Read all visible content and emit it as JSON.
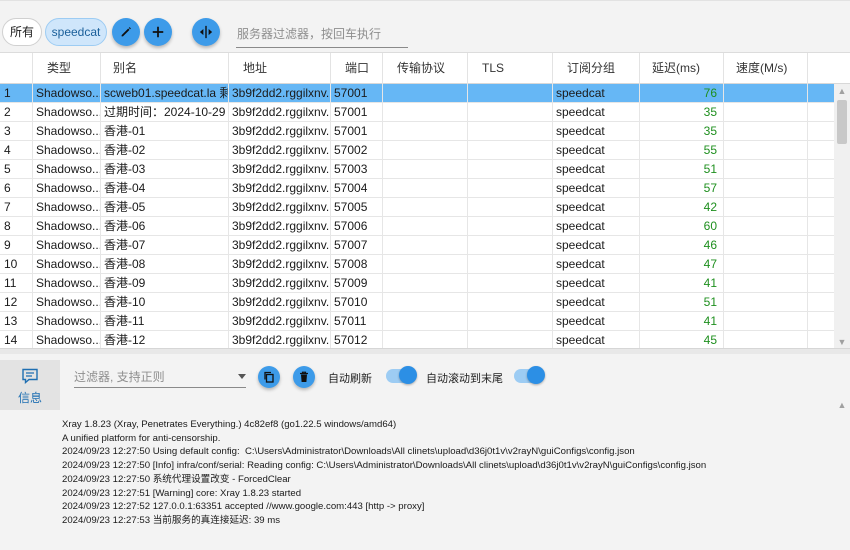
{
  "toolbar": {
    "chip_all": "所有",
    "chip_selected": "speedcat",
    "filter_placeholder": "服务器过滤器，按回车执行"
  },
  "grid": {
    "columns": [
      "",
      "类型",
      "别名",
      "地址",
      "端口",
      "传输协议",
      "TLS",
      "订阅分组",
      "延迟(ms)",
      "速度(M/s)"
    ],
    "rows": [
      {
        "idx": "1",
        "type": "Shadowso...",
        "alias": "scweb01.speedcat.la 剩...",
        "addr": "3b9f2dd2.rggilxnv...",
        "port": "57001",
        "proto": "",
        "tls": "",
        "group": "speedcat",
        "delay": "76",
        "speed": ""
      },
      {
        "idx": "2",
        "type": "Shadowso...",
        "alias": "过期时间：2024-10-29",
        "addr": "3b9f2dd2.rggilxnv...",
        "port": "57001",
        "proto": "",
        "tls": "",
        "group": "speedcat",
        "delay": "35",
        "speed": ""
      },
      {
        "idx": "3",
        "type": "Shadowso...",
        "alias": "香港-01",
        "addr": "3b9f2dd2.rggilxnv...",
        "port": "57001",
        "proto": "",
        "tls": "",
        "group": "speedcat",
        "delay": "35",
        "speed": ""
      },
      {
        "idx": "4",
        "type": "Shadowso...",
        "alias": "香港-02",
        "addr": "3b9f2dd2.rggilxnv...",
        "port": "57002",
        "proto": "",
        "tls": "",
        "group": "speedcat",
        "delay": "55",
        "speed": ""
      },
      {
        "idx": "5",
        "type": "Shadowso...",
        "alias": "香港-03",
        "addr": "3b9f2dd2.rggilxnv...",
        "port": "57003",
        "proto": "",
        "tls": "",
        "group": "speedcat",
        "delay": "51",
        "speed": ""
      },
      {
        "idx": "6",
        "type": "Shadowso...",
        "alias": "香港-04",
        "addr": "3b9f2dd2.rggilxnv...",
        "port": "57004",
        "proto": "",
        "tls": "",
        "group": "speedcat",
        "delay": "57",
        "speed": ""
      },
      {
        "idx": "7",
        "type": "Shadowso...",
        "alias": "香港-05",
        "addr": "3b9f2dd2.rggilxnv...",
        "port": "57005",
        "proto": "",
        "tls": "",
        "group": "speedcat",
        "delay": "42",
        "speed": ""
      },
      {
        "idx": "8",
        "type": "Shadowso...",
        "alias": "香港-06",
        "addr": "3b9f2dd2.rggilxnv...",
        "port": "57006",
        "proto": "",
        "tls": "",
        "group": "speedcat",
        "delay": "60",
        "speed": ""
      },
      {
        "idx": "9",
        "type": "Shadowso...",
        "alias": "香港-07",
        "addr": "3b9f2dd2.rggilxnv...",
        "port": "57007",
        "proto": "",
        "tls": "",
        "group": "speedcat",
        "delay": "46",
        "speed": ""
      },
      {
        "idx": "10",
        "type": "Shadowso...",
        "alias": "香港-08",
        "addr": "3b9f2dd2.rggilxnv...",
        "port": "57008",
        "proto": "",
        "tls": "",
        "group": "speedcat",
        "delay": "47",
        "speed": ""
      },
      {
        "idx": "11",
        "type": "Shadowso...",
        "alias": "香港-09",
        "addr": "3b9f2dd2.rggilxnv...",
        "port": "57009",
        "proto": "",
        "tls": "",
        "group": "speedcat",
        "delay": "41",
        "speed": ""
      },
      {
        "idx": "12",
        "type": "Shadowso...",
        "alias": "香港-10",
        "addr": "3b9f2dd2.rggilxnv...",
        "port": "57010",
        "proto": "",
        "tls": "",
        "group": "speedcat",
        "delay": "51",
        "speed": ""
      },
      {
        "idx": "13",
        "type": "Shadowso...",
        "alias": "香港-11",
        "addr": "3b9f2dd2.rggilxnv...",
        "port": "57011",
        "proto": "",
        "tls": "",
        "group": "speedcat",
        "delay": "41",
        "speed": ""
      },
      {
        "idx": "14",
        "type": "Shadowso...",
        "alias": "香港-12",
        "addr": "3b9f2dd2.rggilxnv...",
        "port": "57012",
        "proto": "",
        "tls": "",
        "group": "speedcat",
        "delay": "45",
        "speed": ""
      }
    ],
    "selected_row": 0
  },
  "nav": {
    "info_label": "信息"
  },
  "log": {
    "filter_placeholder": "过滤器, 支持正则",
    "auto_refresh_label": "自动刷新",
    "auto_refresh_on": true,
    "auto_scroll_label": "自动滚动到末尾",
    "auto_scroll_on": true,
    "lines": [
      "Xray 1.8.23 (Xray, Penetrates Everything.) 4c82ef8 (go1.22.5 windows/amd64)",
      "A unified platform for anti-censorship.",
      "2024/09/23 12:27:50 Using default config:  C:\\Users\\Administrator\\Downloads\\All clinets\\upload\\d36j0t1v\\v2rayN\\guiConfigs\\config.json",
      "2024/09/23 12:27:50 [Info] infra/conf/serial: Reading config: C:\\Users\\Administrator\\Downloads\\All clinets\\upload\\d36j0t1v\\v2rayN\\guiConfigs\\config.json",
      "2024/09/23 12:27:50 系统代理设置改变 - ForcedClear",
      "2024/09/23 12:27:51 [Warning] core: Xray 1.8.23 started",
      "2024/09/23 12:27:52 127.0.0.1:63351 accepted //www.google.com:443 [http -> proxy]",
      "2024/09/23 12:27:53 当前服务的真连接延迟: 39 ms"
    ]
  },
  "colors": {
    "accent": "#3d9be9",
    "selected_row": "#66b7f5",
    "delay_text": "#1e8f1e"
  }
}
